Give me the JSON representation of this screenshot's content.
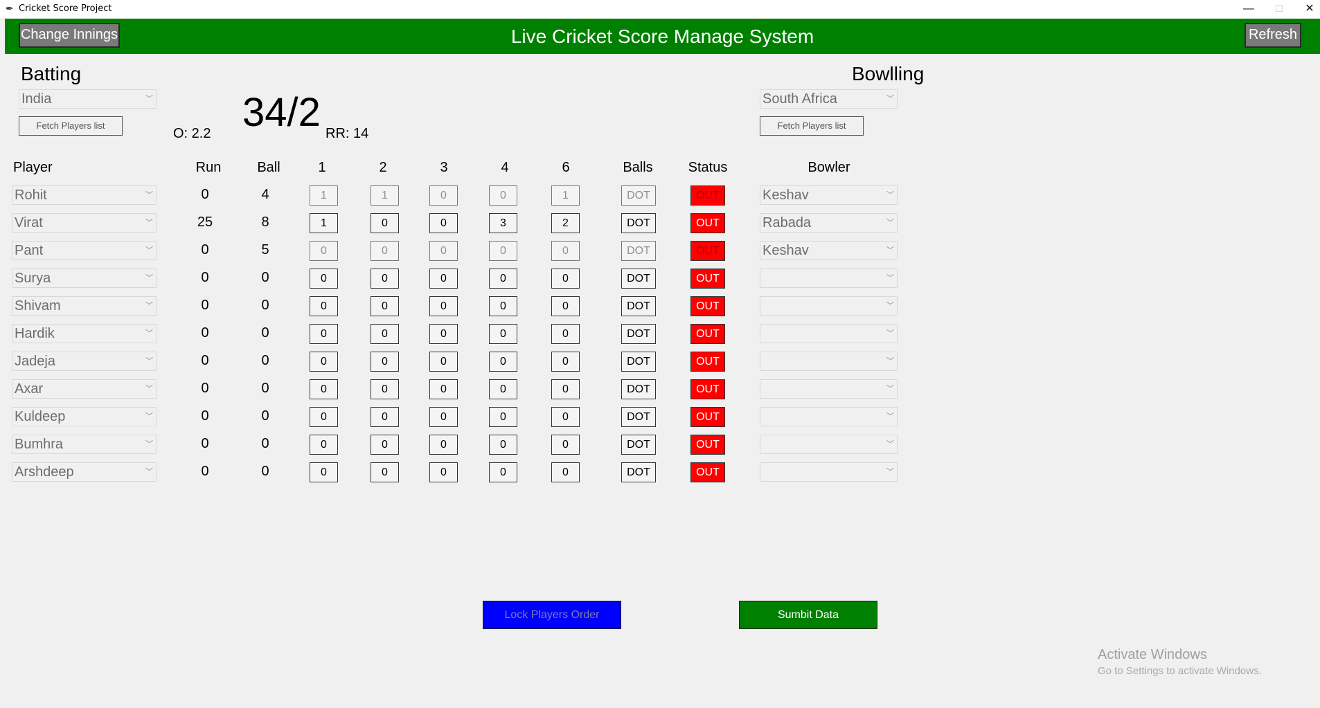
{
  "window": {
    "title": "Cricket Score Project",
    "minimize": "—",
    "maximize": "□",
    "close": "✕"
  },
  "header": {
    "title": "Live Cricket Score Manage System",
    "change_innings": "Change Innings",
    "refresh": "Refresh"
  },
  "batting": {
    "label": "Batting",
    "team": "India",
    "fetch": "Fetch Players list"
  },
  "bowling": {
    "label": "Bowlling",
    "team": "South Africa",
    "fetch": "Fetch Players list"
  },
  "score": {
    "overs": "O: 2.2",
    "total": "34/2",
    "run_rate": "RR: 14"
  },
  "columns": {
    "player": "Player",
    "run": "Run",
    "ball": "Ball",
    "c1": "1",
    "c2": "2",
    "c3": "3",
    "c4": "4",
    "c6": "6",
    "balls": "Balls",
    "status": "Status",
    "bowler": "Bowler"
  },
  "rows": [
    {
      "player": "Rohit",
      "run": "0",
      "ball": "4",
      "c1": "1",
      "c2": "1",
      "c3": "0",
      "c4": "0",
      "c6": "1",
      "dot": "DOT",
      "status": "OUT",
      "bowler": "Keshav",
      "disabled": true
    },
    {
      "player": "Virat",
      "run": "25",
      "ball": "8",
      "c1": "1",
      "c2": "0",
      "c3": "0",
      "c4": "3",
      "c6": "2",
      "dot": "DOT",
      "status": "OUT",
      "bowler": "Rabada",
      "disabled": false
    },
    {
      "player": "Pant",
      "run": "0",
      "ball": "5",
      "c1": "0",
      "c2": "0",
      "c3": "0",
      "c4": "0",
      "c6": "0",
      "dot": "DOT",
      "status": "OUT",
      "bowler": "Keshav",
      "disabled": true
    },
    {
      "player": "Surya",
      "run": "0",
      "ball": "0",
      "c1": "0",
      "c2": "0",
      "c3": "0",
      "c4": "0",
      "c6": "0",
      "dot": "DOT",
      "status": "OUT",
      "bowler": "",
      "disabled": false
    },
    {
      "player": "Shivam",
      "run": "0",
      "ball": "0",
      "c1": "0",
      "c2": "0",
      "c3": "0",
      "c4": "0",
      "c6": "0",
      "dot": "DOT",
      "status": "OUT",
      "bowler": "",
      "disabled": false
    },
    {
      "player": "Hardik",
      "run": "0",
      "ball": "0",
      "c1": "0",
      "c2": "0",
      "c3": "0",
      "c4": "0",
      "c6": "0",
      "dot": "DOT",
      "status": "OUT",
      "bowler": "",
      "disabled": false
    },
    {
      "player": "Jadeja",
      "run": "0",
      "ball": "0",
      "c1": "0",
      "c2": "0",
      "c3": "0",
      "c4": "0",
      "c6": "0",
      "dot": "DOT",
      "status": "OUT",
      "bowler": "",
      "disabled": false
    },
    {
      "player": "Axar",
      "run": "0",
      "ball": "0",
      "c1": "0",
      "c2": "0",
      "c3": "0",
      "c4": "0",
      "c6": "0",
      "dot": "DOT",
      "status": "OUT",
      "bowler": "",
      "disabled": false
    },
    {
      "player": "Kuldeep",
      "run": "0",
      "ball": "0",
      "c1": "0",
      "c2": "0",
      "c3": "0",
      "c4": "0",
      "c6": "0",
      "dot": "DOT",
      "status": "OUT",
      "bowler": "",
      "disabled": false
    },
    {
      "player": "Bumhra",
      "run": "0",
      "ball": "0",
      "c1": "0",
      "c2": "0",
      "c3": "0",
      "c4": "0",
      "c6": "0",
      "dot": "DOT",
      "status": "OUT",
      "bowler": "",
      "disabled": false
    },
    {
      "player": "Arshdeep",
      "run": "0",
      "ball": "0",
      "c1": "0",
      "c2": "0",
      "c3": "0",
      "c4": "0",
      "c6": "0",
      "dot": "DOT",
      "status": "OUT",
      "bowler": "",
      "disabled": false
    }
  ],
  "actions": {
    "lock": "Lock Players Order",
    "submit": "Sumbit Data"
  },
  "watermark": {
    "line1": "Activate Windows",
    "line2": "Go to Settings to activate Windows."
  },
  "colors": {
    "header": "#008000",
    "out": "#ff0000",
    "lock": "#0000ff",
    "submit": "#008000"
  }
}
